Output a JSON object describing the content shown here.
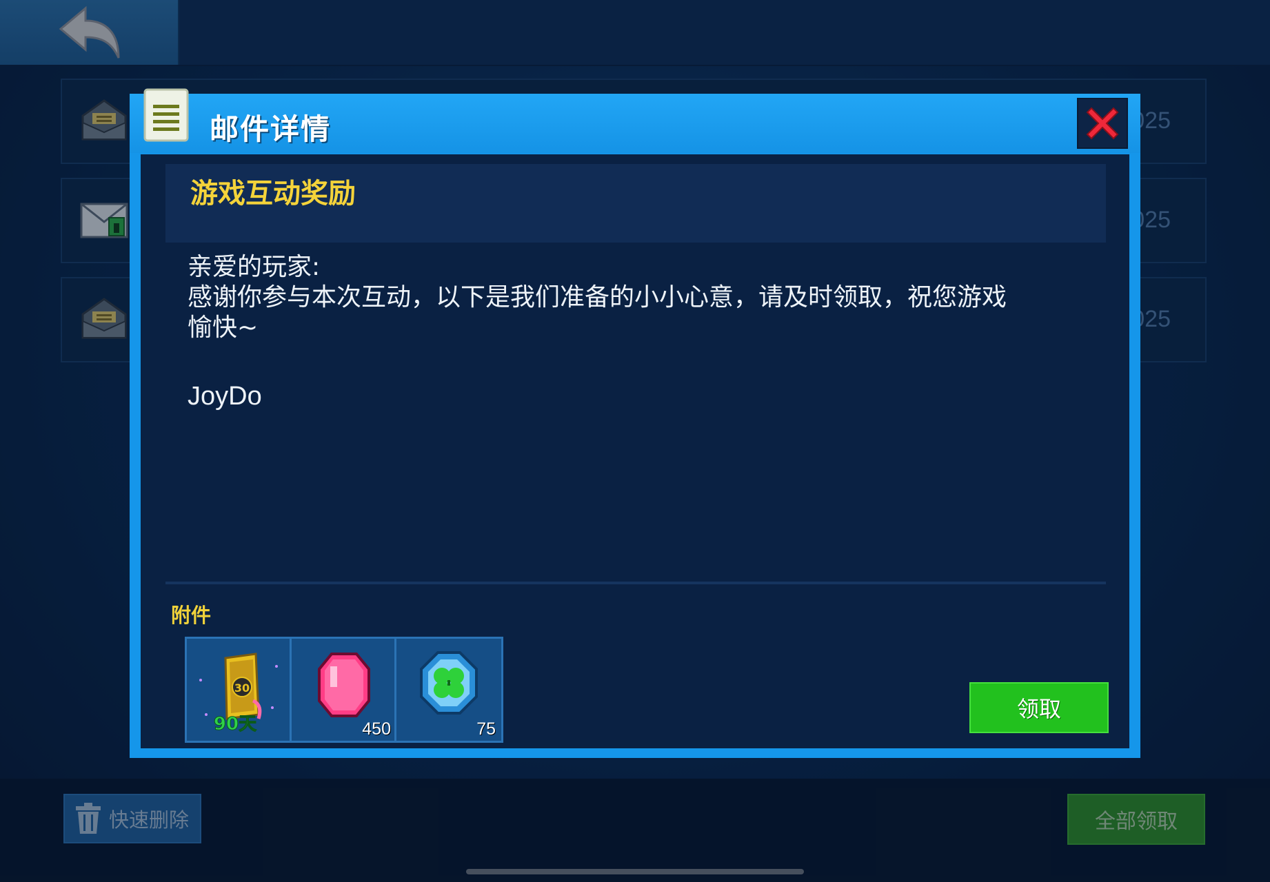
{
  "top_bar": {
    "back_icon": "back-arrow-icon"
  },
  "mail_list": {
    "rows": [
      {
        "icon": "opened-mail-icon",
        "date_fragment": "025"
      },
      {
        "icon": "unopened-mail-icon",
        "date_fragment": "025"
      },
      {
        "icon": "opened-mail-icon",
        "date_fragment": "025"
      }
    ]
  },
  "modal": {
    "title": "邮件详情",
    "title_icon": "document-icon",
    "close_icon": "close-icon",
    "subject": "游戏互动奖励",
    "greeting": "亲爱的玩家:",
    "body_line_1": "感谢你参与本次互动，以下是我们准备的小小心意，请及时领取，祝您游戏",
    "body_line_2": "愉快~",
    "signature": "JoyDo",
    "attachments_label": "附件",
    "attachments": [
      {
        "icon": "card-90-days-icon",
        "qty": ""
      },
      {
        "icon": "pink-gem-icon",
        "qty": "450"
      },
      {
        "icon": "clover-coin-icon",
        "qty": "75"
      }
    ],
    "claim_label": "领取"
  },
  "bottom_bar": {
    "quick_delete_label": "快速删除",
    "claim_all_label": "全部领取"
  },
  "colors": {
    "modal_border": "#1596ea",
    "subject_text": "#f4d33a",
    "claim_green": "#22c11e",
    "close_red": "#f0283a"
  }
}
